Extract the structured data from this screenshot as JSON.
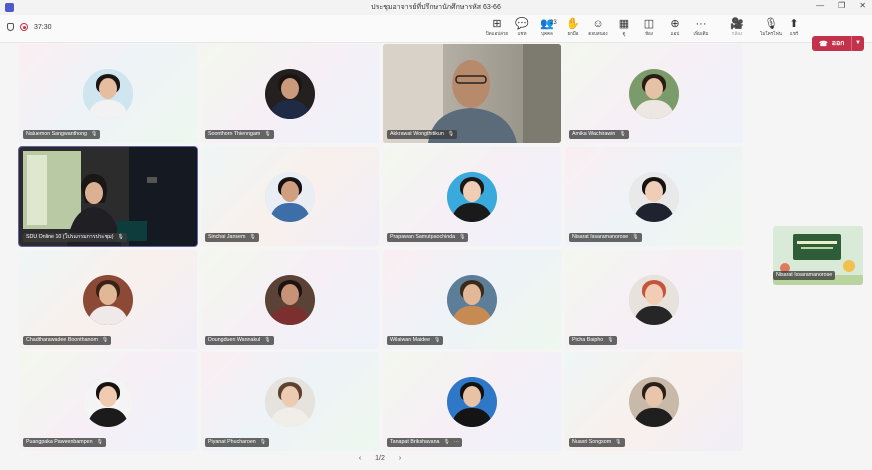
{
  "window": {
    "title": "ประชุมอาจารย์ที่ปรึกษานักศึกษารหัส 63-66",
    "controls": [
      "—",
      "❐",
      "✕"
    ]
  },
  "meeting": {
    "timer": "37:30"
  },
  "toolbar": {
    "buttons": [
      {
        "name": "apps",
        "icon": "apps-icon",
        "label": "ปิดแอปล่วย",
        "glyph": "⊞"
      },
      {
        "name": "chat",
        "icon": "chat-icon",
        "label": "แชท",
        "glyph": "💬"
      },
      {
        "name": "people",
        "icon": "people-icon",
        "label": "บุคคล",
        "glyph": "👥",
        "badge": "23"
      },
      {
        "name": "raise",
        "icon": "hand-icon",
        "label": "ยกมือ",
        "glyph": "✋"
      },
      {
        "name": "react",
        "icon": "smile-icon",
        "label": "ตอบสนอง",
        "glyph": "☺"
      },
      {
        "name": "view",
        "icon": "grid-icon",
        "label": "ดู",
        "glyph": "▦"
      },
      {
        "name": "rooms",
        "icon": "rooms-icon",
        "label": "ห้อง",
        "glyph": "◫"
      },
      {
        "name": "apps-add",
        "icon": "plus-icon",
        "label": "แอป",
        "glyph": "⊕"
      },
      {
        "name": "more",
        "icon": "ellipsis-icon",
        "label": "เพิ่มเติม",
        "glyph": "···"
      },
      {
        "name": "camera",
        "icon": "camera-off-icon",
        "label": "กล้อง",
        "glyph": "🎥",
        "dim": true
      },
      {
        "name": "mic",
        "icon": "mic-off-icon",
        "label": "ไมโครโฟน",
        "glyph": "🎙"
      },
      {
        "name": "share",
        "icon": "share-icon",
        "label": "แชร์",
        "glyph": "⬆"
      }
    ],
    "leave_label": "ออก"
  },
  "participants": [
    {
      "name": "Naluemon Sangwanthong",
      "type": "avatar",
      "skin": "#e6bd9e",
      "hair": "#1a1512",
      "shirt": "#f2f2f2",
      "bg": "#cfe6f1"
    },
    {
      "name": "Soonthorn Thienngam",
      "type": "avatar",
      "skin": "#c99a7c",
      "hair": "#1a1512",
      "shirt": "#1f2a44",
      "bg": "#23201f"
    },
    {
      "name": "Akkrawat Wongthitikun",
      "type": "video"
    },
    {
      "name": "Amika Wachirawin",
      "type": "avatar",
      "skin": "#e5c2a6",
      "hair": "#2b1d15",
      "shirt": "#ece7e2",
      "bg": "#7b9c6a"
    },
    {
      "name": "SDU Online 10 (โปรแกรมการประชุม)",
      "type": "room"
    },
    {
      "name": "Sinchai Jansem",
      "type": "avatar",
      "skin": "#cf9f80",
      "hair": "#141212",
      "shirt": "#3d6ea8",
      "bg": "#e8eef3"
    },
    {
      "name": "Prapawan Samutpaochinda",
      "type": "avatar",
      "skin": "#f0cdb4",
      "hair": "#1d1614",
      "shirt": "#1a1a1a",
      "bg": "#3aa9dd"
    },
    {
      "name": "Nisarat Issaramanorose",
      "type": "avatar",
      "skin": "#efcdb6",
      "hair": "#151212",
      "shirt": "#1e2330",
      "bg": "#e9e9ea"
    },
    {
      "name": "Chadtharawadee Boonthanom",
      "type": "avatar",
      "skin": "#e1b798",
      "hair": "#3a2216",
      "shirt": "#f0e9ea",
      "bg": "#8c4a36"
    },
    {
      "name": "Doungduen Wannakul",
      "type": "avatar",
      "skin": "#c79278",
      "hair": "#1c1411",
      "shirt": "#7b2f2f",
      "bg": "#5a4236"
    },
    {
      "name": "Wilaiwan Maidee",
      "type": "avatar",
      "skin": "#e2b898",
      "hair": "#3a2a1c",
      "shirt": "#c68a52",
      "bg": "#5d7e98"
    },
    {
      "name": "Picha Baipho",
      "type": "avatar",
      "skin": "#f0cdb4",
      "hair": "#c4553b",
      "shirt": "#262626",
      "bg": "#e7e2db"
    },
    {
      "name": "Puangpaka Paweenbampen",
      "type": "avatar",
      "skin": "#f0cbb0",
      "hair": "#171312",
      "shirt": "#1b1b1b",
      "bg": "#f4f4f4"
    },
    {
      "name": "Piyanat Phucharoen",
      "type": "avatar",
      "skin": "#edcbb2",
      "hair": "#5d4230",
      "shirt": "#f1ede8",
      "bg": "#e6e3de"
    },
    {
      "name": "Tanapat Brikshavana",
      "type": "avatar",
      "skin": "#e8c2a5",
      "hair": "#111111",
      "shirt": "#141414",
      "bg": "#2f78c8",
      "more": "···"
    },
    {
      "name": "Nuasri Songsom",
      "type": "avatar",
      "skin": "#e8c5ab",
      "hair": "#2a1e18",
      "shirt": "#1f1f1f",
      "bg": "#c9b9a8"
    }
  ],
  "pager": {
    "text": "1/2",
    "prev": "‹",
    "next": "›"
  },
  "side_video": {
    "name": "Nisarat Issaramanorose"
  }
}
